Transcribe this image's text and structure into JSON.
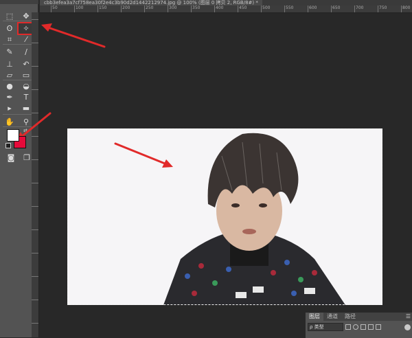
{
  "document": {
    "tab_title": "cbb3efea3a7cf758ea30f2e4c3b90d2d1442212974.jpg @ 100% (图层 0 拷贝 2, RGB/8#) *"
  },
  "ruler": {
    "labels": [
      "50",
      "100",
      "150",
      "200",
      "250",
      "300",
      "350",
      "400",
      "450",
      "500",
      "550",
      "600",
      "650",
      "700",
      "750",
      "800"
    ]
  },
  "toolbar": {
    "tools": [
      {
        "name": "marquee-tool-icon",
        "glyph": "⬚"
      },
      {
        "name": "move-tool-icon",
        "glyph": "✥"
      },
      {
        "name": "lasso-tool-icon",
        "glyph": "ʘ"
      },
      {
        "name": "magic-wand-tool-icon",
        "glyph": "✧",
        "active": true
      },
      {
        "name": "crop-tool-icon",
        "glyph": "⌗"
      },
      {
        "name": "eyedropper-tool-icon",
        "glyph": "⁄"
      },
      {
        "name": "healing-brush-tool-icon",
        "glyph": "✎"
      },
      {
        "name": "brush-tool-icon",
        "glyph": "∕"
      },
      {
        "name": "clone-stamp-tool-icon",
        "glyph": "⊥"
      },
      {
        "name": "history-brush-tool-icon",
        "glyph": "↶"
      },
      {
        "name": "eraser-tool-icon",
        "glyph": "▱"
      },
      {
        "name": "gradient-tool-icon",
        "glyph": "▭"
      },
      {
        "name": "blur-tool-icon",
        "glyph": "●"
      },
      {
        "name": "dodge-tool-icon",
        "glyph": "◒"
      },
      {
        "name": "pen-tool-icon",
        "glyph": "✒"
      },
      {
        "name": "type-tool-icon",
        "glyph": "T"
      },
      {
        "name": "path-selection-tool-icon",
        "glyph": "▸"
      },
      {
        "name": "shape-tool-icon",
        "glyph": "▬"
      },
      {
        "name": "hand-tool-icon",
        "glyph": "✋"
      },
      {
        "name": "zoom-tool-icon",
        "glyph": "⚲"
      }
    ],
    "foreground_color": "#ffffff",
    "background_color": "#e60a3a"
  },
  "layers_panel": {
    "tabs": [
      "图层",
      "通道",
      "路径"
    ],
    "active_tab": "图层",
    "filter_label": "ρ 类型"
  },
  "colors": {
    "annotation_arrow": "#e12a2a",
    "canvas_background": "#f6f5f7"
  }
}
